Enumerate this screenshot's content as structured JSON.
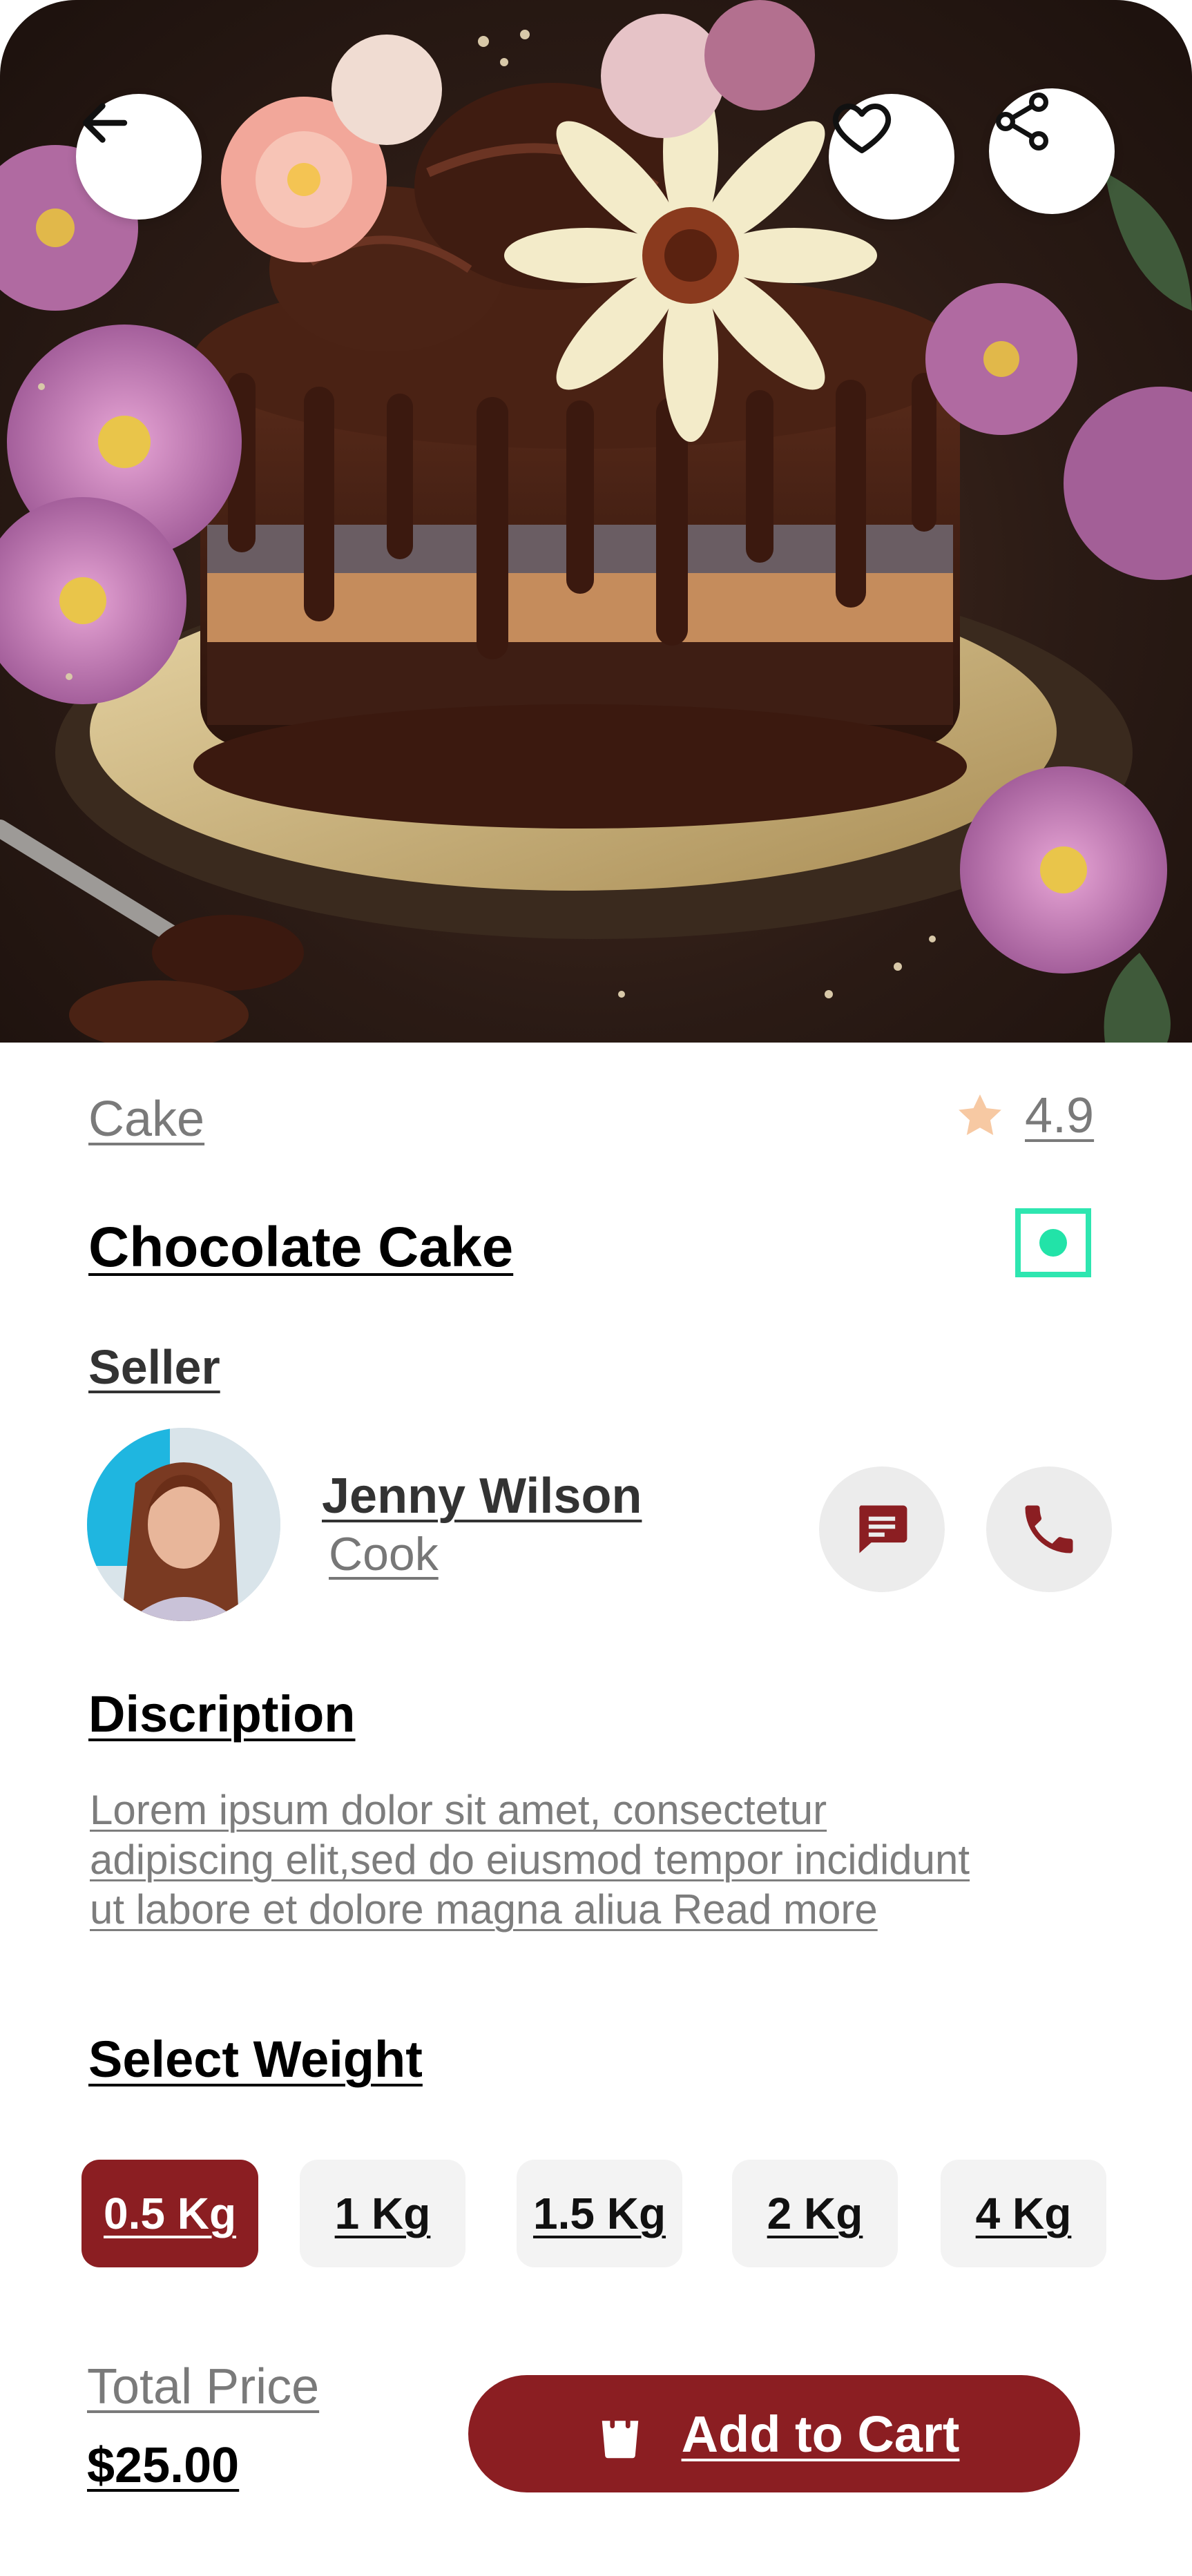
{
  "product": {
    "category": "Cake",
    "rating": "4.9",
    "title": "Chocolate Cake"
  },
  "seller": {
    "heading": "Seller",
    "name": "Jenny Wilson",
    "role": "Cook"
  },
  "description": {
    "heading": "Discription",
    "lines": [
      "Lorem ipsum dolor sit amet, consectetur",
      "adipiscing elit,sed do eiusmod tempor incididunt",
      "ut labore et dolore magna aliua Read more"
    ]
  },
  "weight": {
    "heading": "Select Weight",
    "options": [
      "0.5 Kg",
      "1 Kg",
      "1.5 Kg",
      "2 Kg",
      "4 Kg"
    ],
    "selected": "0.5 Kg"
  },
  "footer": {
    "total_label": "Total Price",
    "total_value": "$25.00",
    "cart_label": "Add to Cart"
  },
  "icons": {
    "back": "arrow-left-icon",
    "favorite": "heart-icon",
    "share": "share-icon",
    "rating": "star-icon",
    "message": "message-icon",
    "call": "phone-icon",
    "cart": "shopping-bag-icon"
  },
  "colors": {
    "accent": "#8b1e22",
    "veg_indicator": "#2ee6b0",
    "star": "#f7c9a3",
    "muted_text": "#7a7a7a"
  }
}
